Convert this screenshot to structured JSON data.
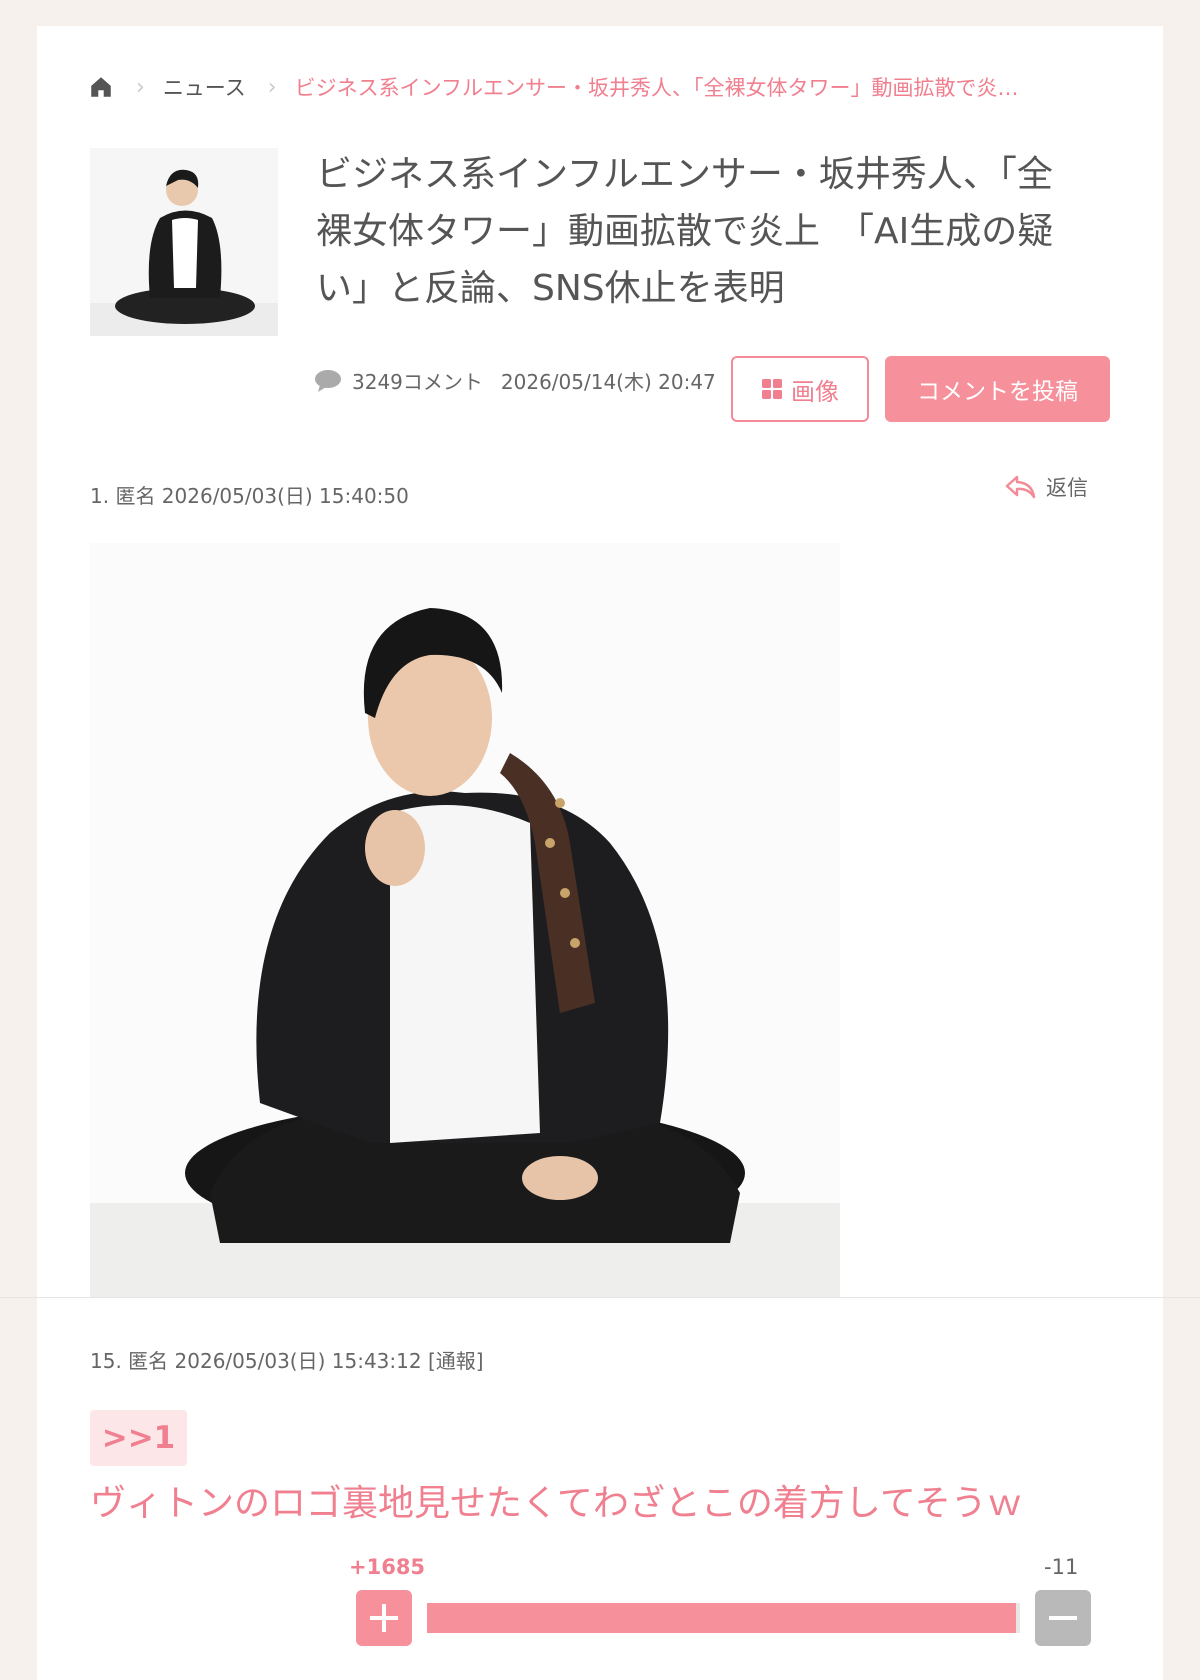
{
  "breadcrumb": {
    "home_icon": "home-icon",
    "separator_icon": "chevron-right-icon",
    "news": "ニュース",
    "current": "ビジネス系インフルエンサー・坂井秀人、「全裸女体タワー」動画拡散で炎…"
  },
  "article": {
    "title_line1": "ビジネス系インフルエンサー・坂井秀人、「全",
    "title_line2": "裸女体タワー」動画拡散で炎上　「AI生成の疑",
    "title_line3": "い」と反論、SNS休止を表明",
    "comment_count": "3249コメント",
    "date": "2026/05/14(木) 20:47",
    "image_button": "画像",
    "post_button": "コメントを投稿"
  },
  "comments": [
    {
      "header": "1. 匿名 2026/05/03(日) 15:40:50",
      "reply_label": "返信"
    },
    {
      "header": "15. 匿名 2026/05/03(日) 15:43:12  [通報]",
      "anchor": ">>1",
      "body": "ヴィトンのロゴ裏地見せたくてわざとこの着方してそうｗ",
      "plus": "+1685",
      "minus": "-11",
      "vote_ratio": 0.993
    }
  ],
  "colors": {
    "accent": "#f07f8f",
    "button_pink": "#f6909b",
    "anchor_bg": "#fde6e8",
    "page_bg": "#f6f1ec"
  }
}
